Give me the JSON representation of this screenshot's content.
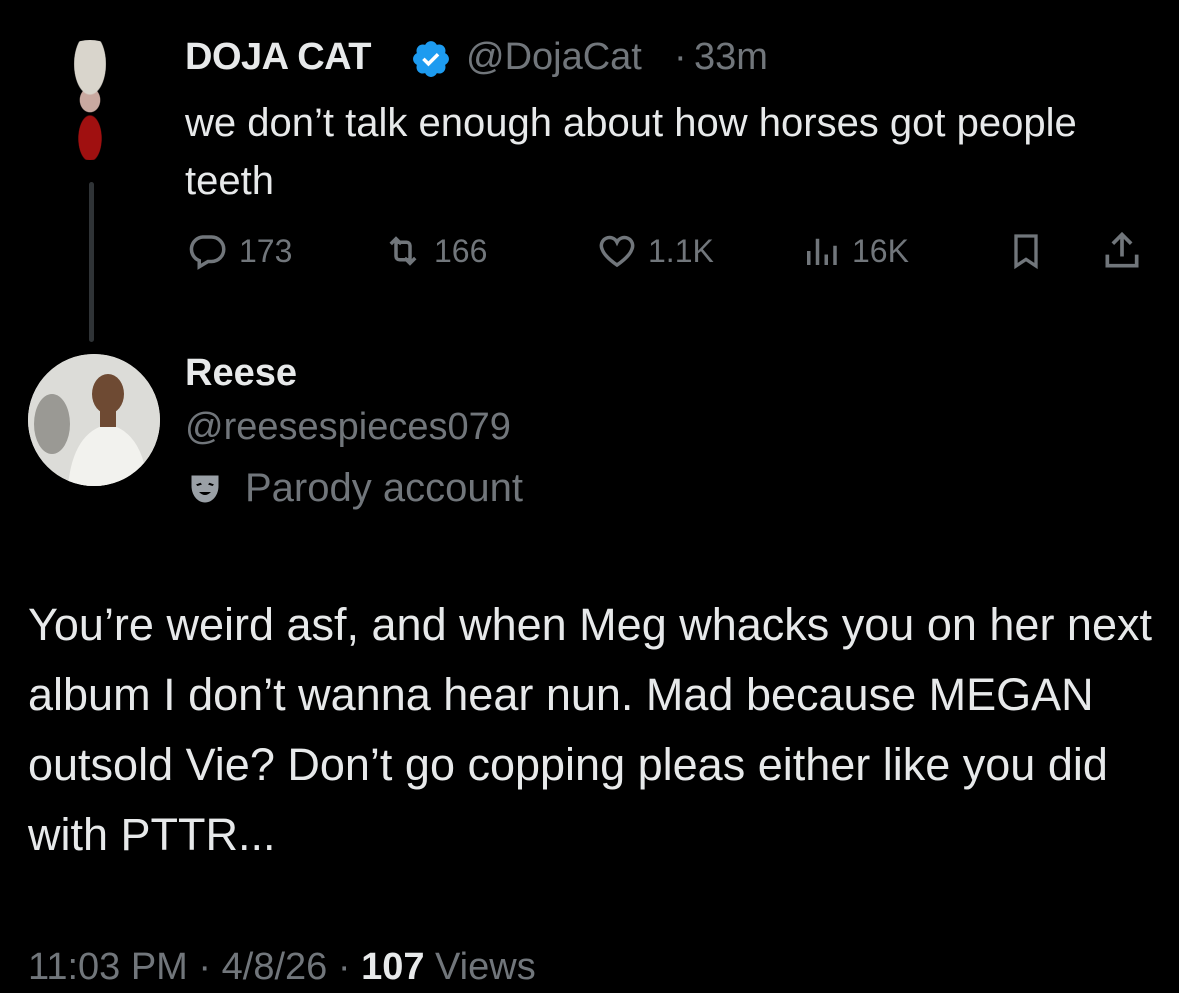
{
  "original_tweet": {
    "display_name": "DOJA CAT",
    "handle": "@DojaCat",
    "separator": "·",
    "time_ago": "33m",
    "text": "we don’t talk enough about how horses got people teeth",
    "metrics": {
      "replies": "173",
      "retweets": "166",
      "likes": "1.1K",
      "views": "16K"
    },
    "icons": [
      "reply-icon",
      "retweet-icon",
      "like-icon",
      "views-icon",
      "bookmark-icon",
      "share-icon"
    ],
    "verified_color": "#1d9bf0"
  },
  "reply_tweet": {
    "display_name": "Reese",
    "handle": "@reesespieces079",
    "label": "Parody account",
    "label_icon": "parody-mask-icon",
    "text": "You’re weird asf, and when Meg whacks you on her next album I don’t wanna hear nun. Mad because MEGAN outsold Vie? Don’t go copping pleas either like you did with PTTR...",
    "footer": {
      "time": "11:03 PM",
      "sep1": " · ",
      "date": "4/8/26",
      "sep2": " · ",
      "views_count": "107",
      "views_label": " Views"
    }
  },
  "colors": {
    "background": "#000000",
    "primary_text": "#e7e9ea",
    "secondary_text": "#71767b",
    "thread_line": "#2f3336"
  }
}
